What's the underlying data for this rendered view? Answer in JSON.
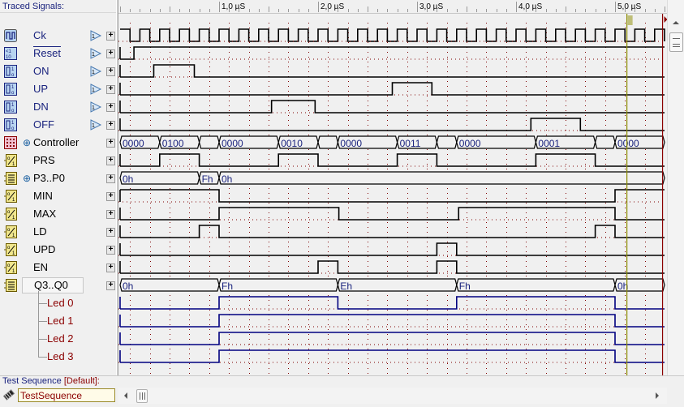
{
  "left_panel": {
    "header": "Traced Signals:",
    "signals": [
      {
        "name": "Ck",
        "icon": "clock-stimulus-icon",
        "color": "#1a237e",
        "overline": false,
        "expander": "",
        "trigger": true
      },
      {
        "name": "Reset",
        "icon": "counter-stimulus-icon",
        "color": "#1a237e",
        "overline": true,
        "expander": "",
        "trigger": true
      },
      {
        "name": "ON",
        "icon": "toggle-stimulus-icon",
        "color": "#1a237e",
        "overline": false,
        "expander": "",
        "trigger": true
      },
      {
        "name": "UP",
        "icon": "toggle-stimulus-icon",
        "color": "#1a237e",
        "overline": false,
        "expander": "",
        "trigger": true
      },
      {
        "name": "DN",
        "icon": "toggle-stimulus-icon",
        "color": "#1a237e",
        "overline": false,
        "expander": "",
        "trigger": true
      },
      {
        "name": "OFF",
        "icon": "toggle-stimulus-icon",
        "color": "#1a237e",
        "overline": false,
        "expander": "",
        "trigger": true
      },
      {
        "name": "Controller",
        "icon": "state-machine-icon",
        "color": "#000000",
        "overline": false,
        "expander": "⊕",
        "trigger": false
      },
      {
        "name": "PRS",
        "icon": "output-signal-icon",
        "color": "#000000",
        "overline": false,
        "expander": "",
        "trigger": false
      },
      {
        "name": "P3..P0",
        "icon": "bus-icon",
        "color": "#000000",
        "overline": false,
        "expander": "⊕",
        "trigger": false
      },
      {
        "name": "MIN",
        "icon": "output-signal-icon",
        "color": "#000000",
        "overline": false,
        "expander": "",
        "trigger": false
      },
      {
        "name": "MAX",
        "icon": "output-signal-icon",
        "color": "#000000",
        "overline": false,
        "expander": "",
        "trigger": false
      },
      {
        "name": "LD",
        "icon": "output-signal-icon",
        "color": "#000000",
        "overline": false,
        "expander": "",
        "trigger": false
      },
      {
        "name": "UPD",
        "icon": "output-signal-icon",
        "color": "#000000",
        "overline": false,
        "expander": "",
        "trigger": false
      },
      {
        "name": "EN",
        "icon": "output-signal-icon",
        "color": "#000000",
        "overline": false,
        "expander": "",
        "trigger": false
      },
      {
        "name": "Q3..Q0",
        "icon": "bus-icon",
        "color": "#000000",
        "overline": false,
        "expander": "⊖",
        "trigger": false,
        "selected": true
      }
    ],
    "children": [
      "Led 0",
      "Led 1",
      "Led 2",
      "Led 3"
    ]
  },
  "time_axis": {
    "unit": "µS",
    "labels": [
      "1,0 µS",
      "2,0 µS",
      "3,0 µS",
      "4,0 µS",
      "5,0 µS"
    ],
    "label_times": [
      1.0,
      2.0,
      3.0,
      4.0,
      5.0
    ],
    "end_time": 5.5,
    "grid_step": 0.2
  },
  "cursors": {
    "yellow_time": 5.12,
    "red_time": 5.48
  },
  "waveforms": [
    {
      "name": "Ck",
      "type": "clock",
      "period": 0.2,
      "first_high": [
        0,
        0.1
      ],
      "color": "#000000"
    },
    {
      "name": "Reset",
      "type": "bit",
      "init": 0,
      "edges": [
        0.14
      ],
      "color": "#000000"
    },
    {
      "name": "ON",
      "type": "bit",
      "init": 0,
      "edges": [
        0.34,
        0.75
      ],
      "color": "#000000"
    },
    {
      "name": "UP",
      "type": "bit",
      "init": 0,
      "edges": [
        2.75,
        3.15
      ],
      "color": "#000000"
    },
    {
      "name": "DN",
      "type": "bit",
      "init": 0,
      "edges": [
        1.53,
        1.97
      ],
      "color": "#000000"
    },
    {
      "name": "OFF",
      "type": "bit",
      "init": 0,
      "edges": [
        4.15,
        4.65
      ],
      "color": "#000000"
    },
    {
      "name": "Controller",
      "type": "bus",
      "color": "#000000",
      "segments": [
        {
          "t0": 0,
          "t1": 0.4,
          "v": "0000"
        },
        {
          "t0": 0.4,
          "t1": 0.8,
          "v": "0100"
        },
        {
          "t0": 0.8,
          "t1": 1.0,
          "v": ""
        },
        {
          "t0": 1.0,
          "t1": 1.6,
          "v": "0000"
        },
        {
          "t0": 1.6,
          "t1": 2.0,
          "v": "0010"
        },
        {
          "t0": 2.0,
          "t1": 2.2,
          "v": ""
        },
        {
          "t0": 2.2,
          "t1": 2.8,
          "v": "0000"
        },
        {
          "t0": 2.8,
          "t1": 3.2,
          "v": "0011"
        },
        {
          "t0": 3.2,
          "t1": 3.4,
          "v": ""
        },
        {
          "t0": 3.4,
          "t1": 4.2,
          "v": "0000"
        },
        {
          "t0": 4.2,
          "t1": 4.8,
          "v": "0001"
        },
        {
          "t0": 4.8,
          "t1": 5.0,
          "v": ""
        },
        {
          "t0": 5.0,
          "t1": 5.5,
          "v": "0000"
        }
      ]
    },
    {
      "name": "PRS",
      "type": "bit",
      "init": 0,
      "edges": [
        0.4,
        0.8,
        1.6,
        2.0,
        2.8,
        3.2,
        4.2,
        4.8
      ],
      "color": "#000000"
    },
    {
      "name": "P3..P0",
      "type": "bus",
      "color": "#000000",
      "segments": [
        {
          "t0": 0,
          "t1": 0.8,
          "v": "0h"
        },
        {
          "t0": 0.8,
          "t1": 1.0,
          "v": "Fh"
        },
        {
          "t0": 1.0,
          "t1": 5.5,
          "v": "0h"
        }
      ]
    },
    {
      "name": "MIN",
      "type": "bit",
      "init": 1,
      "edges": [
        1.0,
        5.0
      ],
      "color": "#000000"
    },
    {
      "name": "MAX",
      "type": "bit",
      "init": 0,
      "edges": [
        1.0,
        2.21,
        3.42,
        5.0
      ],
      "color": "#000000"
    },
    {
      "name": "LD",
      "type": "bit",
      "init": 0,
      "edges": [
        0.8,
        1.0,
        4.8,
        5.0
      ],
      "color": "#000000"
    },
    {
      "name": "UPD",
      "type": "bit",
      "init": 0,
      "edges": [
        3.2,
        3.4
      ],
      "color": "#000000"
    },
    {
      "name": "EN",
      "type": "bit",
      "init": 0,
      "edges": [
        2.0,
        2.2,
        3.2,
        3.4
      ],
      "color": "#000000"
    },
    {
      "name": "Q3..Q0",
      "type": "bus",
      "color": "#000000",
      "segments": [
        {
          "t0": 0,
          "t1": 1.0,
          "v": "0h"
        },
        {
          "t0": 1.0,
          "t1": 2.2,
          "v": "Fh"
        },
        {
          "t0": 2.2,
          "t1": 3.4,
          "v": "Eh"
        },
        {
          "t0": 3.4,
          "t1": 5.0,
          "v": "Fh"
        },
        {
          "t0": 5.0,
          "t1": 5.5,
          "v": "0h"
        }
      ]
    },
    {
      "name": "Led 0",
      "type": "bit",
      "init": 0,
      "edges": [
        1.0,
        2.2,
        3.4,
        5.0
      ],
      "color": "#000080"
    },
    {
      "name": "Led 1",
      "type": "bit",
      "init": 0,
      "edges": [
        1.0,
        5.0
      ],
      "color": "#000080"
    },
    {
      "name": "Led 2",
      "type": "bit",
      "init": 0,
      "edges": [
        1.0,
        5.0
      ],
      "color": "#000080"
    },
    {
      "name": "Led 3",
      "type": "bit",
      "init": 0,
      "edges": [
        1.0,
        5.0
      ],
      "color": "#000080"
    }
  ],
  "colors": {
    "grid": "#800000",
    "signal": "#000000",
    "led": "#000080",
    "bus_text": "#1a237e",
    "cursor_yellow": "#8b8b00",
    "cursor_red": "#8b0000"
  },
  "test_sequence": {
    "label": "Test Sequence",
    "default_tag": "[Default]:",
    "value": "TestSequence"
  }
}
